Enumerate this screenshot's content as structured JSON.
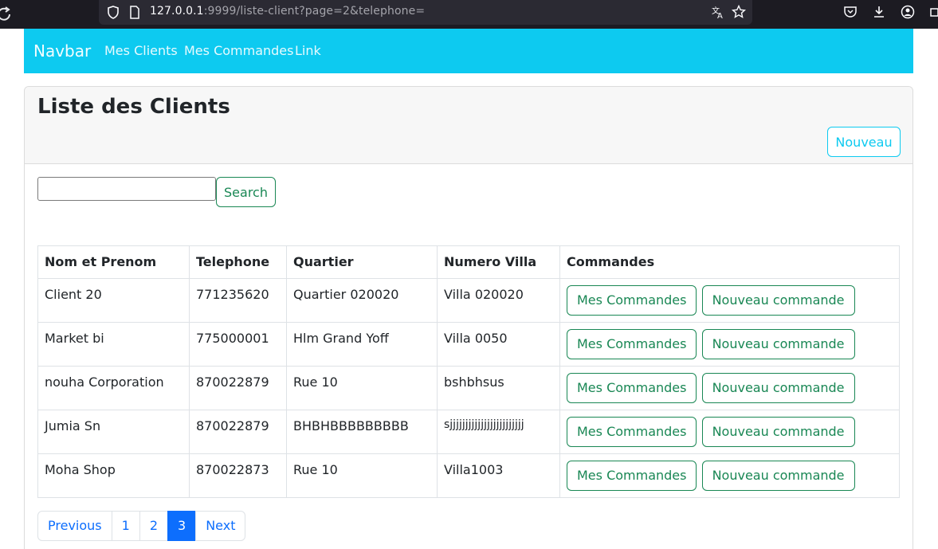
{
  "browser": {
    "url_host": "127.0.0.1",
    "url_rest": ":9999/liste-client?page=2&telephone="
  },
  "navbar": {
    "brand": "Navbar",
    "links": [
      "Mes Clients",
      "Mes Commandes",
      "Link"
    ],
    "color": "#0dcaf0"
  },
  "card": {
    "title": "Liste des Clients",
    "new_button": "Nouveau"
  },
  "search": {
    "value": "",
    "button": "Search"
  },
  "table": {
    "headers": [
      "Nom et Prenom",
      "Telephone",
      "Quartier",
      "Numero Villa",
      "Commandes"
    ],
    "rows": [
      {
        "nom": "Client 20",
        "telephone": "771235620",
        "quartier": "Quartier 020020",
        "villa": "Villa 020020"
      },
      {
        "nom": "Market bi",
        "telephone": "775000001",
        "quartier": "Hlm Grand Yoff",
        "villa": "Villa 0050"
      },
      {
        "nom": "nouha Corporation",
        "telephone": "870022879",
        "quartier": "Rue 10",
        "villa": "bshbhsus"
      },
      {
        "nom": "Jumia Sn",
        "telephone": "870022879",
        "quartier": "BHBHBBBBBBBBB",
        "villa": "sjjjjjjjjjjjjjjjjjjjjjjjj"
      },
      {
        "nom": "Moha Shop",
        "telephone": "870022873",
        "quartier": "Rue 10",
        "villa": "Villa1003"
      }
    ],
    "row_buttons": {
      "mes_commandes": "Mes Commandes",
      "nouveau_commande": "Nouveau commande"
    }
  },
  "pagination": {
    "previous": "Previous",
    "pages": [
      "1",
      "2",
      "3"
    ],
    "active": "3",
    "next": "Next"
  }
}
